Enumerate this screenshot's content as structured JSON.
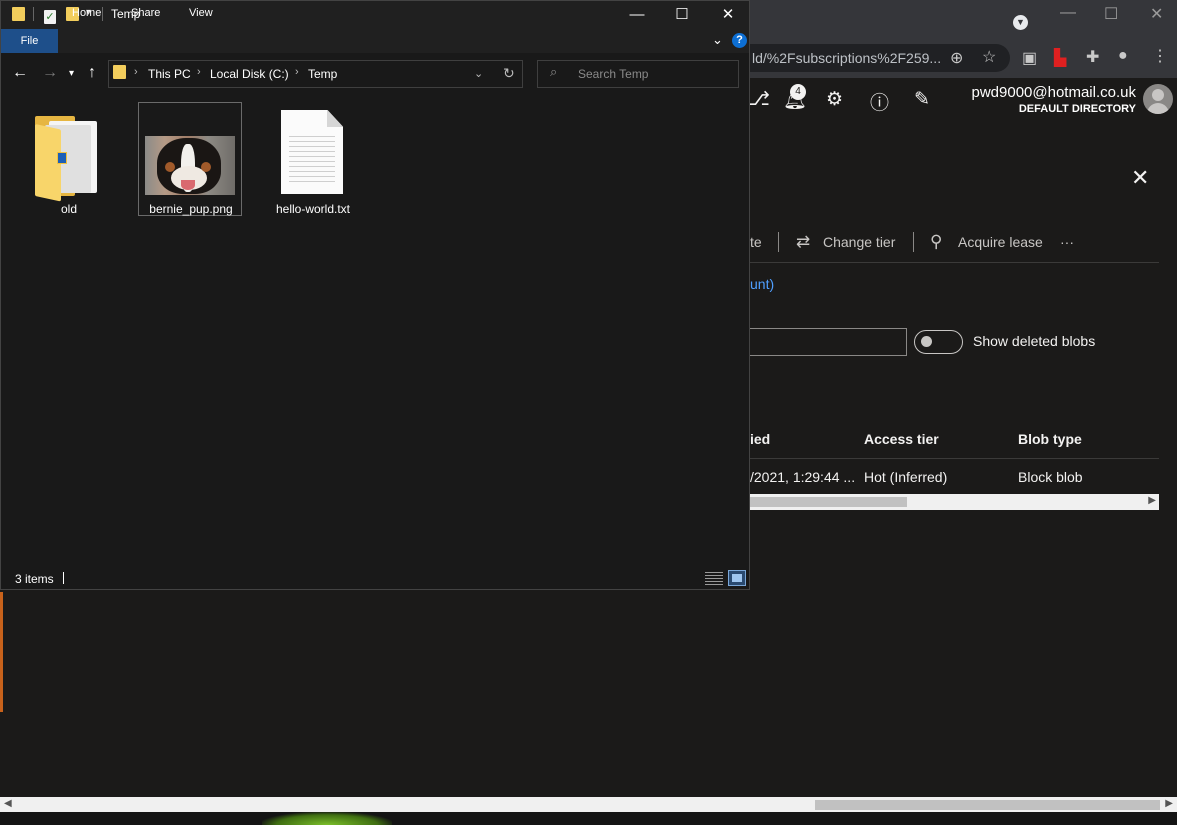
{
  "browser": {
    "url_fragment": "ld/%2Fsubscriptions%2F259...",
    "notification_count": "4",
    "user_email": "pwd9000@hotmail.co.uk",
    "directory": "DEFAULT DIRECTORY"
  },
  "azure": {
    "commands": {
      "truncated": "te",
      "change_tier": "Change tier",
      "acquire_lease": "Acquire lease",
      "more": "···"
    },
    "link_fragment": "unt)",
    "show_deleted_label": "Show deleted blobs",
    "table": {
      "headers": [
        "ied",
        "Access tier",
        "Blob type"
      ],
      "row": [
        "/2021, 1:29:44 ...",
        "Hot (Inferred)",
        "Block blob"
      ]
    }
  },
  "explorer": {
    "title": "Temp",
    "ribbon_tabs": [
      "File",
      "Home",
      "Share",
      "View"
    ],
    "breadcrumbs": [
      "This PC",
      "Local Disk (C:)",
      "Temp"
    ],
    "search_placeholder": "Search Temp",
    "items": [
      {
        "name": "old",
        "type": "folder"
      },
      {
        "name": "bernie_pup.png",
        "type": "image"
      },
      {
        "name": "hello-world.txt",
        "type": "text"
      }
    ],
    "status": "3 items"
  }
}
